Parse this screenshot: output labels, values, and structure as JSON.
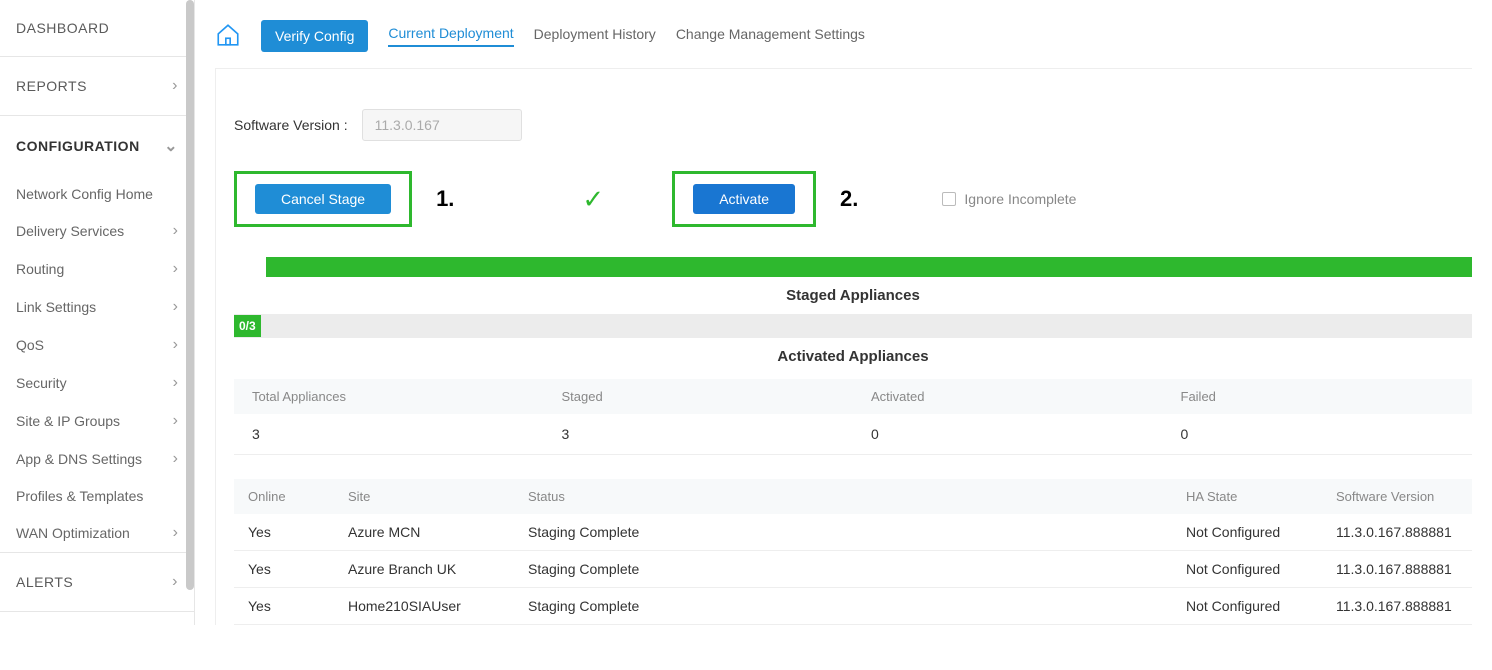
{
  "sidebar": {
    "dashboard": "DASHBOARD",
    "reports": "REPORTS",
    "configuration": "CONFIGURATION",
    "items": [
      {
        "label": "Network Config Home",
        "expandable": false
      },
      {
        "label": "Delivery Services",
        "expandable": true
      },
      {
        "label": "Routing",
        "expandable": true
      },
      {
        "label": "Link Settings",
        "expandable": true
      },
      {
        "label": "QoS",
        "expandable": true
      },
      {
        "label": "Security",
        "expandable": true
      },
      {
        "label": "Site & IP Groups",
        "expandable": true
      },
      {
        "label": "App & DNS Settings",
        "expandable": true
      },
      {
        "label": "Profiles & Templates",
        "expandable": false
      },
      {
        "label": "WAN Optimization",
        "expandable": true
      }
    ],
    "alerts": "ALERTS"
  },
  "tabs": {
    "verify": "Verify Config",
    "current": "Current Deployment",
    "history": "Deployment History",
    "change": "Change Management Settings"
  },
  "software_version": {
    "label": "Software Version :",
    "value": "11.3.0.167"
  },
  "actions": {
    "cancel_stage": "Cancel Stage",
    "activate": "Activate",
    "step1": "1.",
    "step2": "2.",
    "ignore_incomplete": "Ignore Incomplete"
  },
  "sections": {
    "staged": "Staged Appliances",
    "activated": "Activated Appliances",
    "progress_badge": "0/3"
  },
  "summary": {
    "headers": {
      "total": "Total Appliances",
      "staged": "Staged",
      "activated": "Activated",
      "failed": "Failed"
    },
    "values": {
      "total": "3",
      "staged": "3",
      "activated": "0",
      "failed": "0"
    }
  },
  "table": {
    "headers": {
      "online": "Online",
      "site": "Site",
      "status": "Status",
      "hastate": "HA State",
      "swv": "Software Version"
    },
    "rows": [
      {
        "online": "Yes",
        "site": "Azure MCN",
        "status": "Staging Complete",
        "hastate": "Not Configured",
        "swv": "11.3.0.167.888881"
      },
      {
        "online": "Yes",
        "site": "Azure Branch UK",
        "status": "Staging Complete",
        "hastate": "Not Configured",
        "swv": "11.3.0.167.888881"
      },
      {
        "online": "Yes",
        "site": "Home210SIAUser",
        "status": "Staging Complete",
        "hastate": "Not Configured",
        "swv": "11.3.0.167.888881"
      }
    ]
  }
}
